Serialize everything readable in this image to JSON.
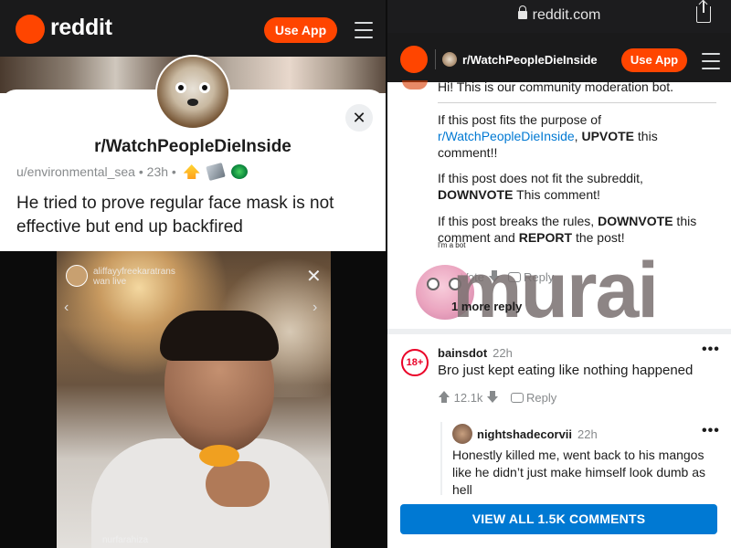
{
  "left": {
    "header": {
      "logo_text": "reddit",
      "use_app": "Use App"
    },
    "post": {
      "subreddit": "r/WatchPeopleDieInside",
      "author": "u/environmental_sea",
      "time": "23h",
      "separator": "•",
      "title": "He tried to prove regular face mask is not effective but end up backfired",
      "close_glyph": "✕"
    },
    "video": {
      "live_user": "aliffayyfreekaratrans",
      "live_sub": "wan live",
      "bottom_user": "nurfarahiza",
      "close_glyph": "✕",
      "chev_left": "‹",
      "chev_right": "›"
    }
  },
  "right": {
    "browser": {
      "url": "reddit.com"
    },
    "header": {
      "subreddit": "r/WatchPeopleDieInside",
      "use_app": "Use App"
    },
    "bot_comment": {
      "intro": "Hi! This is our community moderation bot.",
      "p1_pre": "If this post fits the purpose of ",
      "p1_link": "r/WatchPeopleDieInside",
      "p1_mid": ", ",
      "p1_bold": "UPVOTE",
      "p1_post": " this comment!!",
      "p2_pre": "If this post does not fit the subreddit, ",
      "p2_bold": "DOWNVOTE",
      "p2_post": " This comment!",
      "p3_pre": "If this post breaks the rules, ",
      "p3_bold1": "DOWNVOTE",
      "p3_mid": " this comment and ",
      "p3_bold2": "REPORT",
      "p3_post": " the post!",
      "bot_tag": "I'm a bot",
      "vote_label": "Vote",
      "reply_label": "Reply",
      "more_replies": "1 more reply"
    },
    "watermark": {
      "text": "murai"
    },
    "comment": {
      "avatar_text": "18+",
      "user": "bainsdot",
      "time": "22h",
      "body": "Bro just kept eating like nothing happened",
      "votes": "12.1k",
      "reply_label": "Reply",
      "menu": "•••"
    },
    "reply": {
      "user": "nightshadecorvii",
      "time": "22h",
      "body": "Honestly killed me, went back to his mangos like he didn’t just make himself look dumb as hell",
      "menu": "•••"
    },
    "view_all": "VIEW ALL 1.5K COMMENTS"
  },
  "colors": {
    "reddit_orange": "#ff4500",
    "link_blue": "#0079d3",
    "nsfw_red": "#ea0027"
  }
}
